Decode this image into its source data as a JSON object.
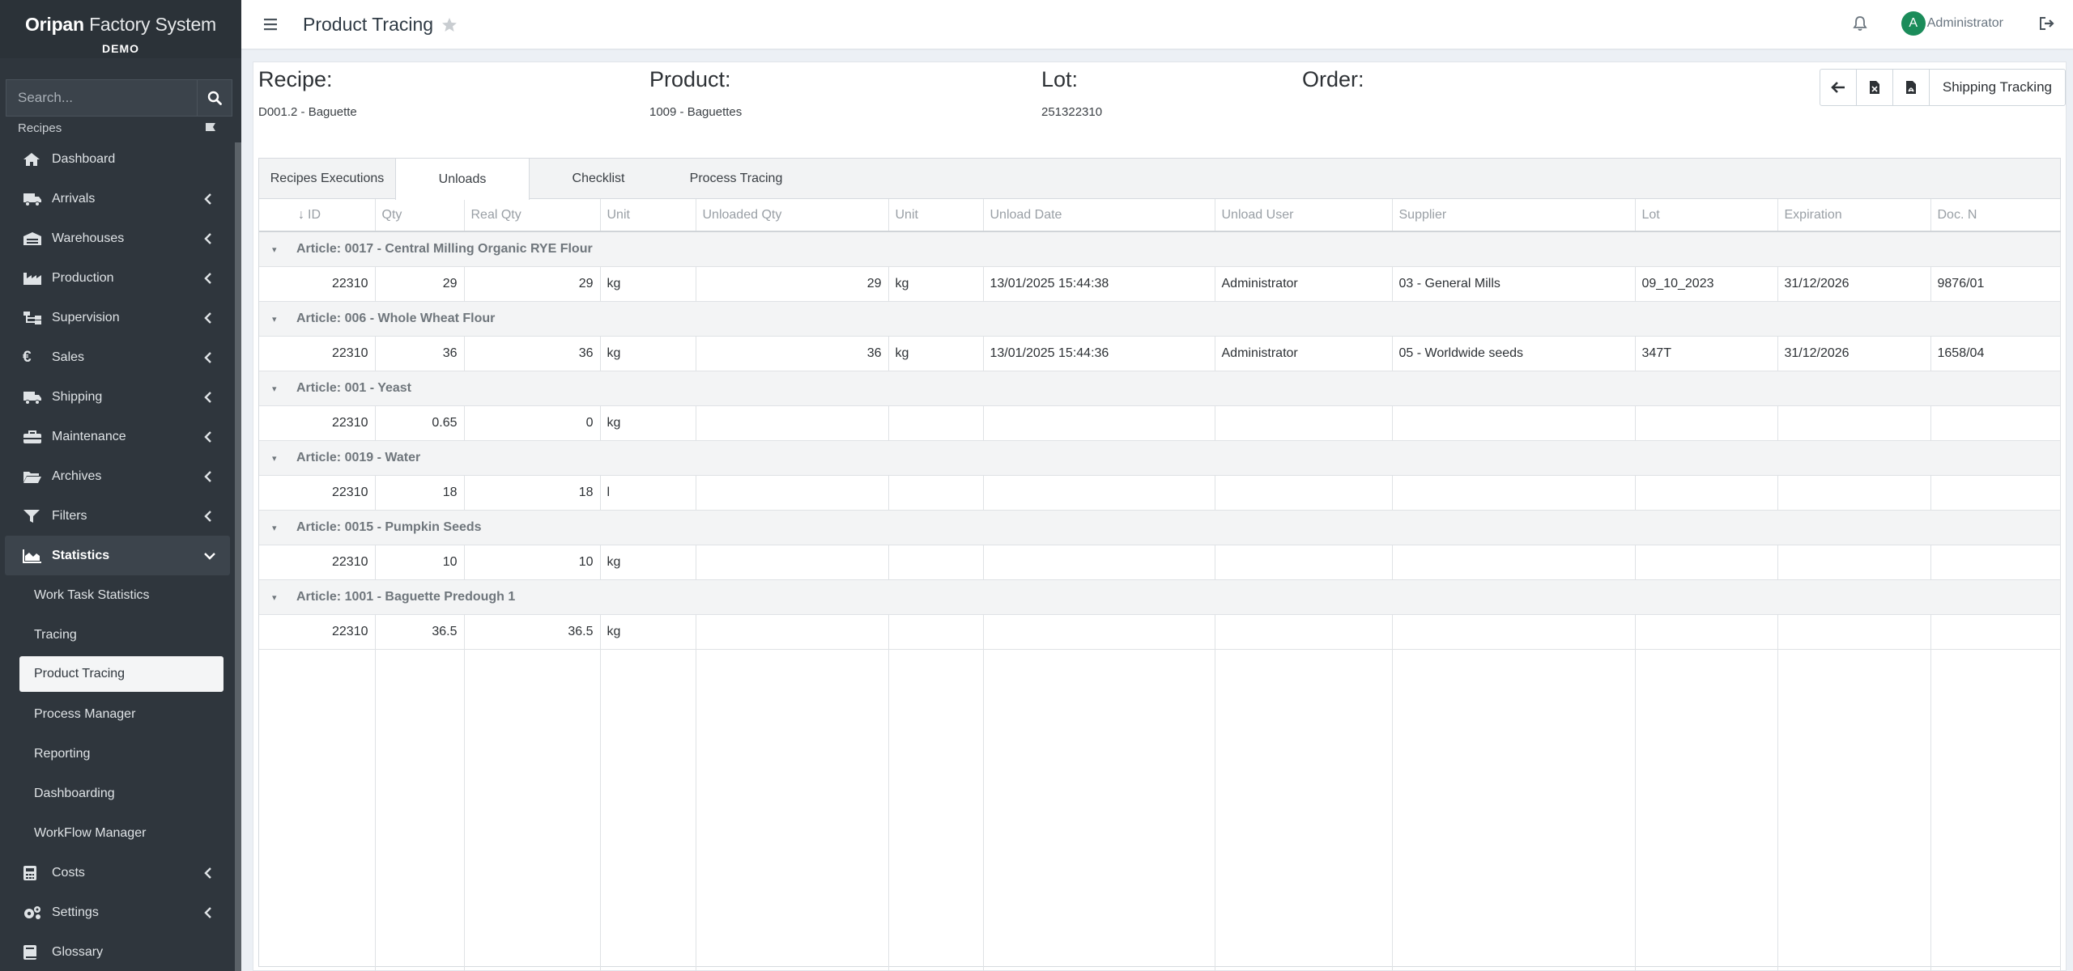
{
  "app": {
    "brand_bold": "Oripan",
    "brand_rest": " Factory System",
    "brand_sub": "DEMO"
  },
  "search": {
    "placeholder": "Search..."
  },
  "sidebar": {
    "recipes_label": "Recipes",
    "items": [
      {
        "label": "Dashboard",
        "icon": "home-icon"
      },
      {
        "label": "Arrivals",
        "icon": "truck-icon"
      },
      {
        "label": "Warehouses",
        "icon": "warehouse-icon"
      },
      {
        "label": "Production",
        "icon": "industry-icon"
      },
      {
        "label": "Supervision",
        "icon": "sitemap-icon"
      },
      {
        "label": "Sales",
        "icon": "euro-icon"
      },
      {
        "label": "Shipping",
        "icon": "truck-icon"
      },
      {
        "label": "Maintenance",
        "icon": "toolbox-icon"
      },
      {
        "label": "Archives",
        "icon": "folder-open-icon"
      },
      {
        "label": "Filters",
        "icon": "filter-icon"
      },
      {
        "label": "Statistics",
        "icon": "area-chart-icon"
      }
    ],
    "statistics_sub": [
      "Work Task Statistics",
      "Tracing",
      "Product Tracing",
      "Process Manager",
      "Reporting",
      "Dashboarding",
      "WorkFlow Manager"
    ],
    "bottom_items": [
      {
        "label": "Costs",
        "icon": "calculator-icon"
      },
      {
        "label": "Settings",
        "icon": "cogs-icon"
      },
      {
        "label": "Glossary",
        "icon": "book-icon"
      }
    ]
  },
  "topbar": {
    "title": "Product Tracing",
    "avatar_letter": "A",
    "user": "Administrator"
  },
  "header": {
    "recipe_label": "Recipe:",
    "recipe_value": "D001.2 - Baguette",
    "product_label": "Product:",
    "product_value": "1009 - Baguettes",
    "lot_label": "Lot:",
    "lot_value": "251322310",
    "order_label": "Order:",
    "order_value": ""
  },
  "actions": {
    "shipping_tracking": "Shipping Tracking"
  },
  "tabs": [
    "Recipes Executions",
    "Unloads",
    "Checklist",
    "Process Tracing"
  ],
  "active_tab": "Unloads",
  "columns": [
    "ID",
    "Qty",
    "Real Qty",
    "Unit",
    "Unloaded Qty",
    "Unit",
    "Unload Date",
    "Unload User",
    "Supplier",
    "Lot",
    "Expiration",
    "Doc. N"
  ],
  "groups": [
    {
      "article": "Article: 0017 - Central Milling Organic RYE Flour",
      "row": [
        "22310",
        "29",
        "29",
        "kg",
        "29",
        "kg",
        "13/01/2025 15:44:38",
        "Administrator",
        "03 - General Mills",
        "09_10_2023",
        "31/12/2026",
        "9876/01"
      ]
    },
    {
      "article": "Article: 006 - Whole Wheat Flour",
      "row": [
        "22310",
        "36",
        "36",
        "kg",
        "36",
        "kg",
        "13/01/2025 15:44:36",
        "Administrator",
        "05 - Worldwide seeds",
        "347T",
        "31/12/2026",
        "1658/04"
      ]
    },
    {
      "article": "Article: 001 - Yeast",
      "row": [
        "22310",
        "0.65",
        "0",
        "kg",
        "",
        "",
        "",
        "",
        "",
        "",
        "",
        ""
      ]
    },
    {
      "article": "Article: 0019 - Water",
      "row": [
        "22310",
        "18",
        "18",
        "l",
        "",
        "",
        "",
        "",
        "",
        "",
        "",
        ""
      ]
    },
    {
      "article": "Article: 0015 - Pumpkin Seeds",
      "row": [
        "22310",
        "10",
        "10",
        "kg",
        "",
        "",
        "",
        "",
        "",
        "",
        "",
        ""
      ]
    },
    {
      "article": "Article: 1001 - Baguette Predough 1",
      "row": [
        "22310",
        "36.5",
        "36.5",
        "kg",
        "",
        "",
        "",
        "",
        "",
        "",
        "",
        ""
      ]
    }
  ]
}
